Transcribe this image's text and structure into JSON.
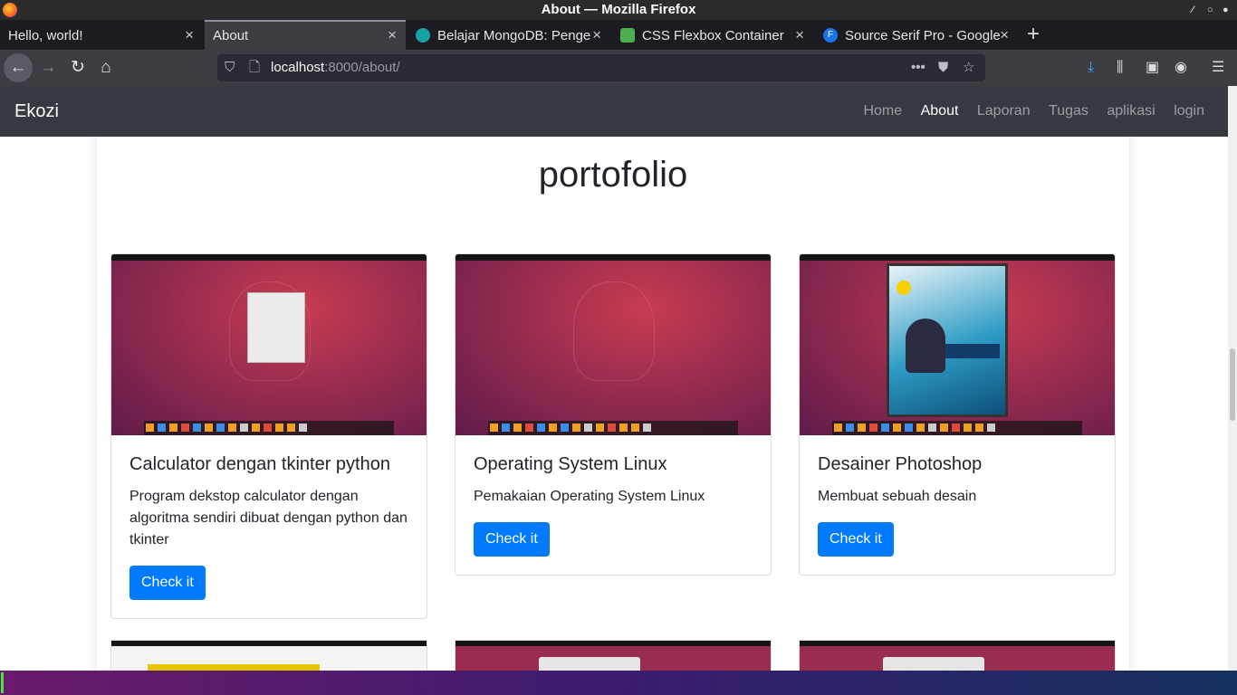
{
  "window": {
    "title": "About — Mozilla Firefox"
  },
  "tabs": [
    {
      "label": "Hello, world!",
      "active": false
    },
    {
      "label": "About",
      "active": true
    },
    {
      "label": "Belajar MongoDB: Penge",
      "active": false,
      "favicon_color": "#17a2a2"
    },
    {
      "label": "CSS Flexbox Container",
      "active": false,
      "favicon_color": "#4caf50"
    },
    {
      "label": "Source Serif Pro - Google",
      "active": false,
      "favicon_color": "#1a73e8",
      "favicon_letter": "F"
    }
  ],
  "address": {
    "host": "localhost",
    "path": ":8000/about/"
  },
  "site": {
    "brand": "Ekozi",
    "menu": [
      "Home",
      "About",
      "Laporan",
      "Tugas",
      "aplikasi",
      "login"
    ],
    "active_menu": "About"
  },
  "page": {
    "heading": "portofolio",
    "cards": [
      {
        "title": "Calculator dengan tkinter python",
        "text": "Program dekstop calculator dengan algoritma sendiri dibuat dengan python dan tkinter",
        "button": "Check it"
      },
      {
        "title": "Operating System Linux",
        "text": "Pemakaian Operating System Linux",
        "button": "Check it"
      },
      {
        "title": "Desainer Photoshop",
        "text": "Membuat sebuah desain",
        "button": "Check it"
      }
    ]
  },
  "colors": {
    "primary": "#007bff",
    "header": "#343a40",
    "toolbar": "#3d3c42",
    "tabstrip": "#1c1b22"
  }
}
